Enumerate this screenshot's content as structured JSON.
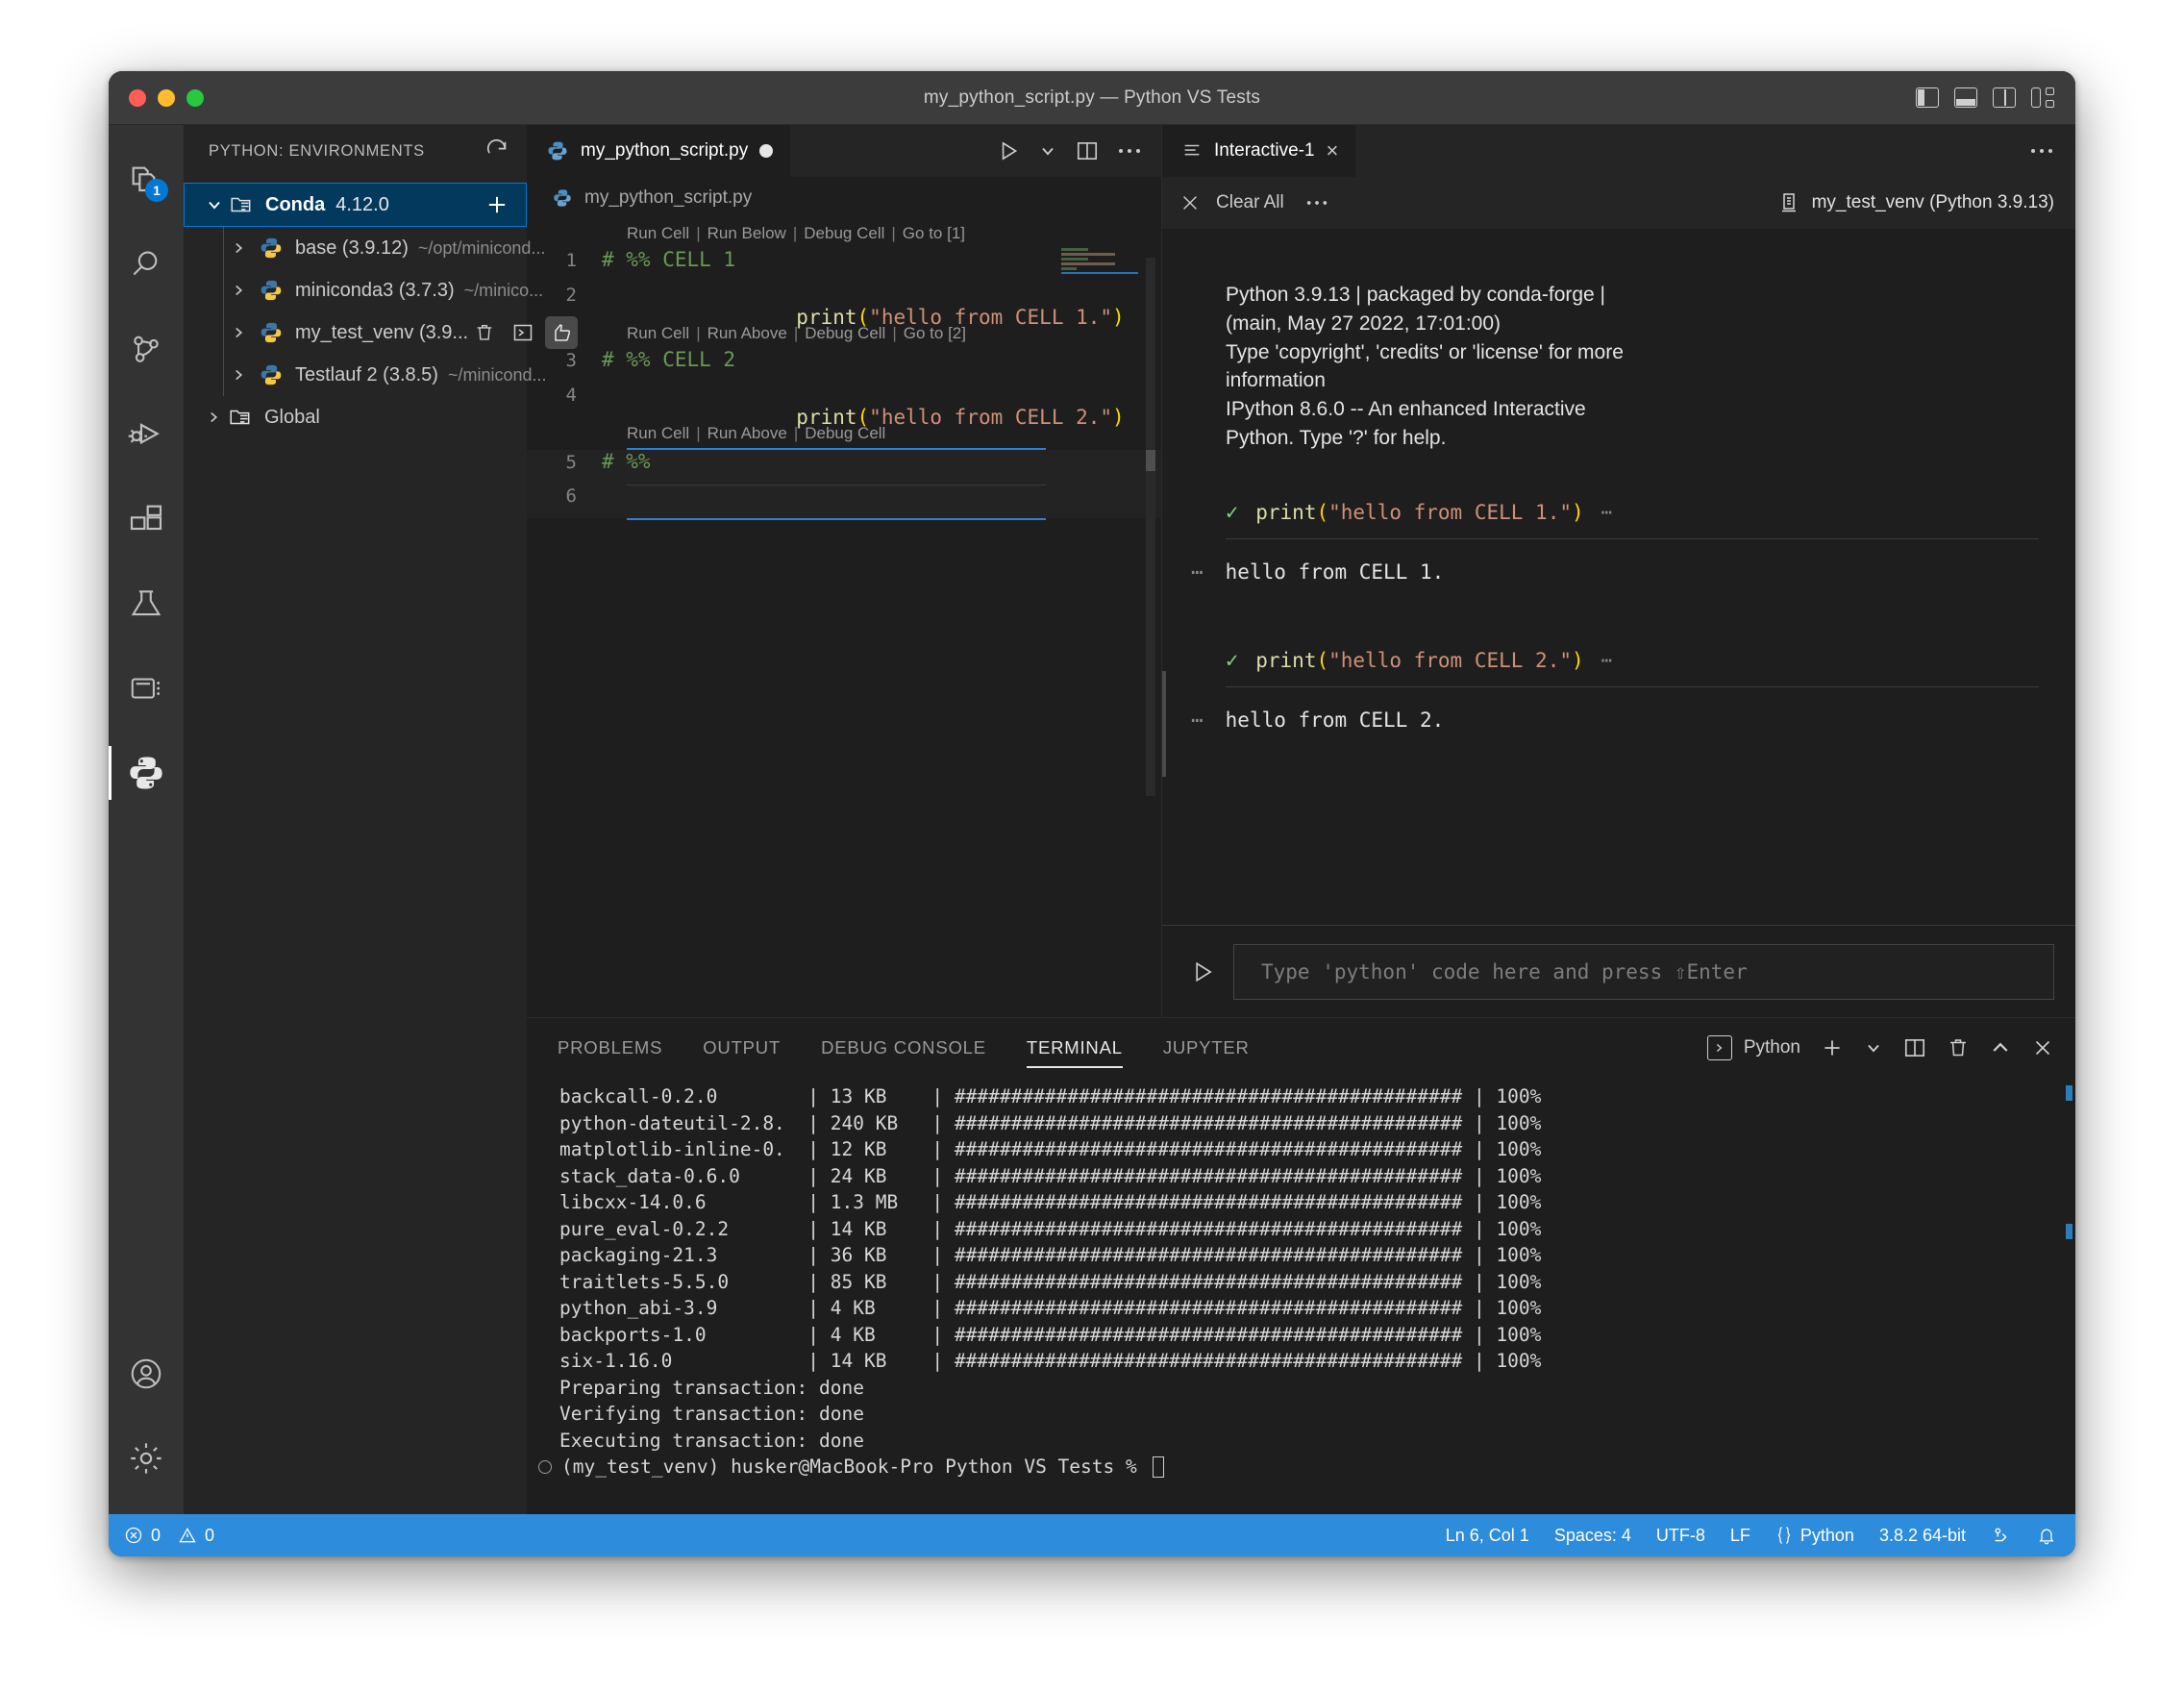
{
  "window": {
    "title": "my_python_script.py — Python VS Tests",
    "traffic_lights": [
      "close",
      "minimize",
      "zoom"
    ],
    "layout_icons": [
      "toggle-primary-sidebar",
      "toggle-panel",
      "toggle-secondary-sidebar",
      "customize-layout"
    ]
  },
  "activitybar": {
    "items": [
      {
        "name": "explorer",
        "badge": "1"
      },
      {
        "name": "search",
        "badge": ""
      },
      {
        "name": "source-control",
        "badge": ""
      },
      {
        "name": "run-and-debug",
        "badge": ""
      },
      {
        "name": "extensions",
        "badge": ""
      },
      {
        "name": "testing",
        "badge": ""
      },
      {
        "name": "jupyter",
        "badge": ""
      },
      {
        "name": "python-environments",
        "badge": ""
      }
    ],
    "bottom": [
      {
        "name": "accounts"
      },
      {
        "name": "manage-settings"
      }
    ]
  },
  "sidebar": {
    "title": "PYTHON: ENVIRONMENTS",
    "refresh_icon": "refresh-icon",
    "tree": [
      {
        "label": "Conda",
        "version": "4.12.0",
        "path": "",
        "selected": true,
        "expanded": true,
        "kind": "group",
        "action": "+"
      },
      {
        "label": "base (3.9.12)",
        "path": "~/opt/minicond...",
        "kind": "env",
        "expanded": false
      },
      {
        "label": "miniconda3 (3.7.3)",
        "path": "~/minico...",
        "kind": "env",
        "expanded": false
      },
      {
        "label": "my_test_venv (3.9...",
        "path": "",
        "kind": "env",
        "expanded": false,
        "actions": [
          "trash-icon",
          "terminal-icon",
          "thumbs-up-icon"
        ]
      },
      {
        "label": "Testlauf 2 (3.8.5)",
        "path": "~/minicond...",
        "kind": "env",
        "expanded": false
      },
      {
        "label": "Global",
        "version": "",
        "path": "",
        "kind": "group",
        "expanded": false
      }
    ]
  },
  "editor": {
    "tab": {
      "label": "my_python_script.py",
      "dirty": true,
      "icon": "python-file-icon"
    },
    "tab_actions": [
      "run-python-file-icon",
      "chevron-down-icon",
      "split-editor-icon",
      "more-actions-icon"
    ],
    "breadcrumb": "my_python_script.py",
    "codelenses": {
      "cell1": [
        "Run Cell",
        "Run Below",
        "Debug Cell",
        "Go to [1]"
      ],
      "cell2": [
        "Run Cell",
        "Run Above",
        "Debug Cell",
        "Go to [2]"
      ],
      "cell3": [
        "Run Cell",
        "Run Above",
        "Debug Cell"
      ]
    },
    "lines": [
      {
        "n": "1",
        "kind": "comment",
        "text": "# %% CELL 1"
      },
      {
        "n": "2",
        "kind": "print",
        "fn": "print",
        "open": "(",
        "str": "\"hello from CELL 1.\"",
        "close": ")"
      },
      {
        "n": "3",
        "kind": "comment",
        "text": "# %% CELL 2"
      },
      {
        "n": "4",
        "kind": "print",
        "fn": "print",
        "open": "(",
        "str": "\"hello from CELL 2.\"",
        "close": ")"
      },
      {
        "n": "5",
        "kind": "comment",
        "text": "# %%"
      },
      {
        "n": "6",
        "kind": "blank",
        "text": ""
      }
    ]
  },
  "interactive": {
    "tab": {
      "label": "Interactive-1",
      "icon": "interactive-window-icon",
      "close": "×"
    },
    "more_actions": "more-actions-icon",
    "toolbar": {
      "clear_all": "Clear All",
      "clear_icon": "close-icon",
      "more": "more-actions-icon",
      "kernel_icon": "server-icon",
      "kernel": "my_test_venv (Python 3.9.13)"
    },
    "banner": [
      "Python 3.9.13 | packaged by conda-forge |",
      "(main, May 27 2022, 17:01:00)",
      "Type 'copyright', 'credits' or 'license' for more",
      "information",
      "IPython 8.6.0 -- An enhanced Interactive",
      "Python. Type '?' for help."
    ],
    "cells": [
      {
        "status": "✓",
        "code_fn": "print",
        "code_open": "(",
        "code_str": "\"hello from CELL 1.\"",
        "code_close": ")",
        "trailing": "⋯",
        "out_marker": "⋯",
        "output": "hello from CELL 1."
      },
      {
        "status": "✓",
        "code_fn": "print",
        "code_open": "(",
        "code_str": "\"hello from CELL 2.\"",
        "code_close": ")",
        "trailing": "⋯",
        "out_marker": "⋯",
        "output": "hello from CELL 2."
      }
    ],
    "input": {
      "run_icon": "run-icon",
      "placeholder": "Type 'python' code here and press ⇧Enter"
    }
  },
  "panel": {
    "tabs": [
      "PROBLEMS",
      "OUTPUT",
      "DEBUG CONSOLE",
      "TERMINAL",
      "JUPYTER"
    ],
    "active_tab": "TERMINAL",
    "actions": {
      "terminal_label": "Python",
      "terminal_icon": "terminal-icon",
      "new_terminal": "+",
      "new_terminal_dropdown": "chevron-down-icon",
      "split_terminal": "split-icon",
      "kill_terminal": "trash-icon",
      "maximize_panel": "chevron-up-icon",
      "close_panel": "close-icon"
    },
    "terminal_lines": [
      {
        "pkg": "backcall-0.2.0",
        "size": "13 KB",
        "bar": "#############################################",
        "pct": "100%"
      },
      {
        "pkg": "python-dateutil-2.8.",
        "size": "240 KB",
        "bar": "#############################################",
        "pct": "100%"
      },
      {
        "pkg": "matplotlib-inline-0.",
        "size": "12 KB",
        "bar": "#############################################",
        "pct": "100%"
      },
      {
        "pkg": "stack_data-0.6.0",
        "size": "24 KB",
        "bar": "#############################################",
        "pct": "100%"
      },
      {
        "pkg": "libcxx-14.0.6",
        "size": "1.3 MB",
        "bar": "#############################################",
        "pct": "100%"
      },
      {
        "pkg": "pure_eval-0.2.2",
        "size": "14 KB",
        "bar": "#############################################",
        "pct": "100%"
      },
      {
        "pkg": "packaging-21.3",
        "size": "36 KB",
        "bar": "#############################################",
        "pct": "100%"
      },
      {
        "pkg": "traitlets-5.5.0",
        "size": "85 KB",
        "bar": "#############################################",
        "pct": "100%"
      },
      {
        "pkg": "python_abi-3.9",
        "size": "4 KB",
        "bar": "#############################################",
        "pct": "100%"
      },
      {
        "pkg": "backports-1.0",
        "size": "4 KB",
        "bar": "#############################################",
        "pct": "100%"
      },
      {
        "pkg": "six-1.16.0",
        "size": "14 KB",
        "bar": "#############################################",
        "pct": "100%"
      }
    ],
    "terminal_messages": [
      "Preparing transaction: done",
      "Verifying transaction: done",
      "Executing transaction: done"
    ],
    "terminal_prompt": "(my_test_venv) husker@MacBook-Pro Python VS Tests %"
  },
  "statusbar": {
    "errors": "0",
    "warnings": "0",
    "error_icon": "error-icon",
    "warning_icon": "warning-icon",
    "position": "Ln 6, Col 1",
    "spaces": "Spaces: 4",
    "encoding": "UTF-8",
    "eol": "LF",
    "language_icon": "braces-icon",
    "language": "Python",
    "interpreter": "3.8.2 64-bit",
    "remote_icon": "remote-icon",
    "bell_icon": "bell-icon",
    "accent": "#2d8cdb"
  }
}
